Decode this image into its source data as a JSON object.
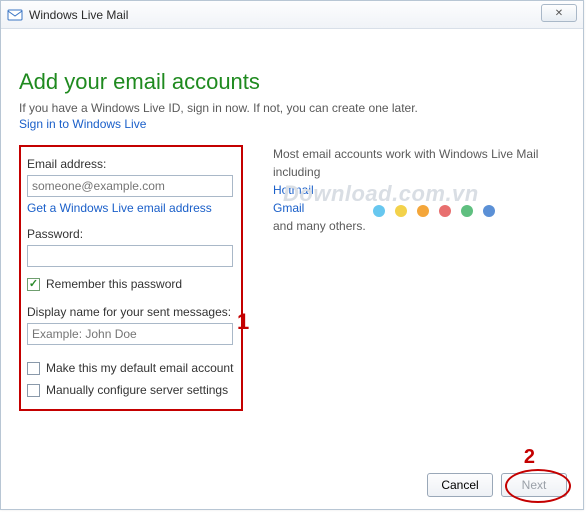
{
  "titlebar": {
    "title": "Windows Live Mail",
    "close": "✕"
  },
  "heading": "Add your email accounts",
  "subtitle": "If you have a Windows Live ID, sign in now. If not, you can create one later.",
  "signin_link": "Sign in to Windows Live",
  "form": {
    "email_label": "Email address:",
    "email_placeholder": "someone@example.com",
    "get_address_link": "Get a Windows Live email address",
    "password_label": "Password:",
    "remember_label": "Remember this password",
    "display_label": "Display name for your sent messages:",
    "display_placeholder": "Example: John Doe",
    "default_label": "Make this my default email account",
    "manual_label": "Manually configure server settings"
  },
  "info": {
    "line1": "Most email accounts work with Windows Live Mail including",
    "providers": [
      "Hotmail",
      "Gmail"
    ],
    "line2": "and many others.",
    "watermark": "Download.com.vn"
  },
  "dots": [
    "#67c7ef",
    "#f3d24b",
    "#f4a63a",
    "#e86f6f",
    "#5fbf7f",
    "#5b90d6"
  ],
  "buttons": {
    "cancel": "Cancel",
    "next": "Next"
  },
  "annotations": {
    "a1": "1",
    "a2": "2"
  }
}
